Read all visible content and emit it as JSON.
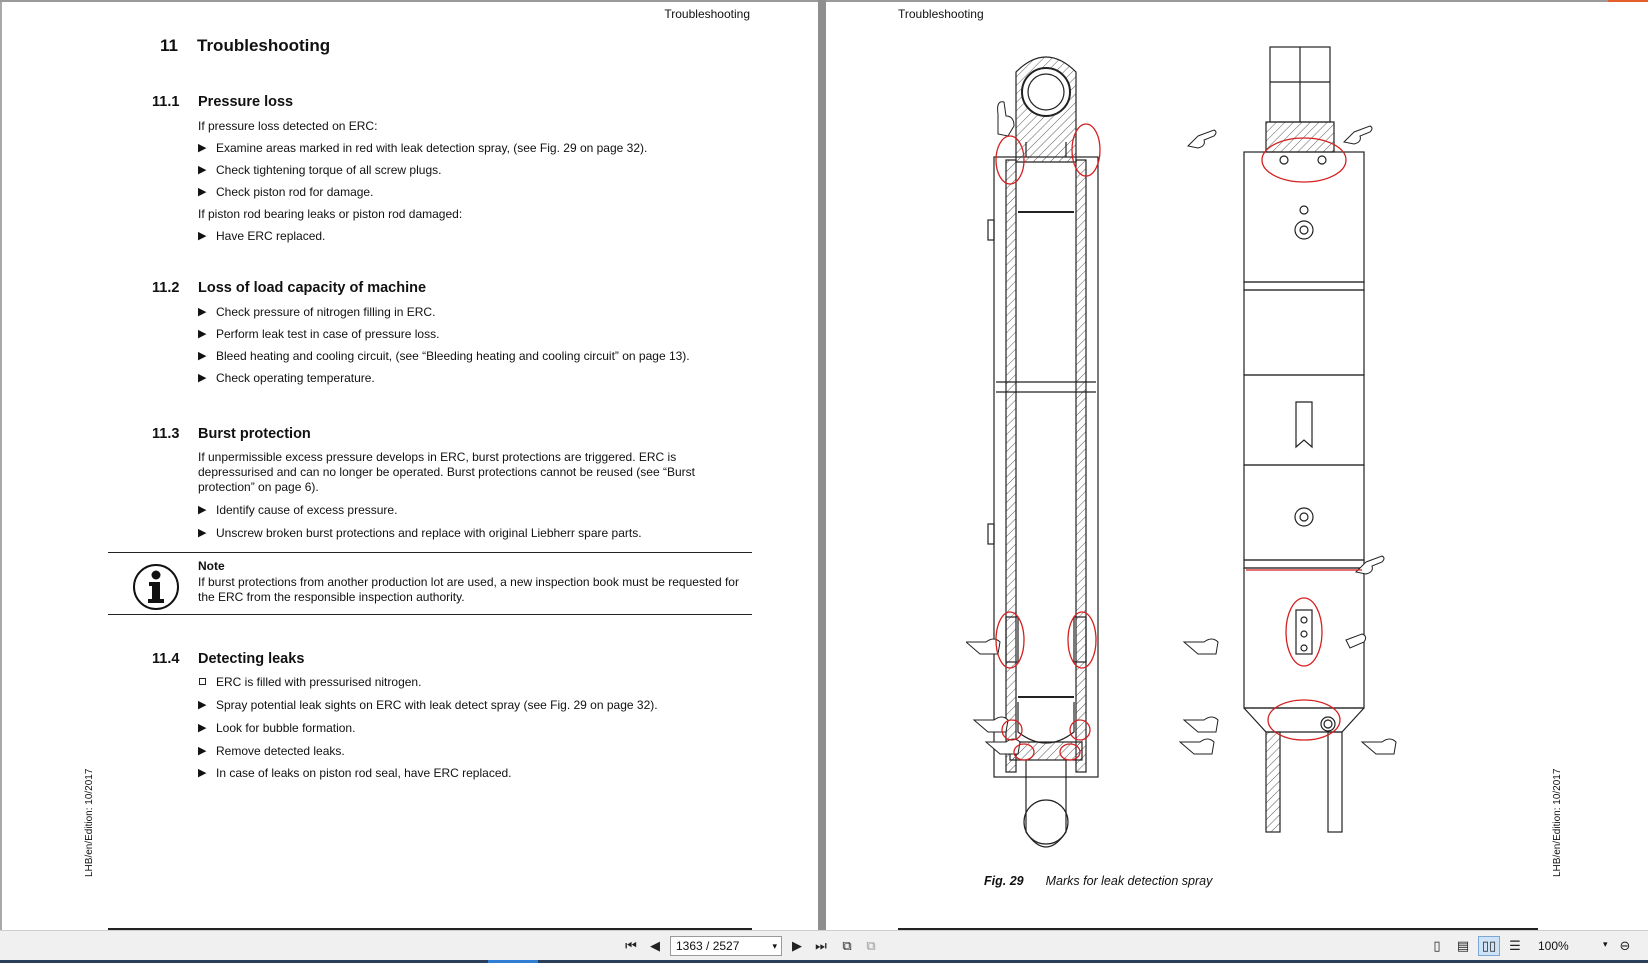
{
  "viewer": {
    "page_indicator": "1363 / 2527",
    "zoom": "100%",
    "icons": [
      "first-page-icon",
      "previous-page-icon",
      "next-page-icon",
      "last-page-icon",
      "copy-icon",
      "fit-icon",
      "single-page-icon",
      "continuous-icon",
      "two-page-icon",
      "two-page-continuous-icon",
      "zoom-out-icon"
    ]
  },
  "left_page": {
    "running_header": "Troubleshooting",
    "chapter": {
      "num": "11",
      "title": "Troubleshooting"
    },
    "s1": {
      "num": "11.1",
      "title": "Pressure loss",
      "intro": "If pressure loss detected on ERC:",
      "b1": "Examine areas marked in red with leak detection spray, (see Fig. 29 on page 32).",
      "b2": "Check tightening torque of all screw plugs.",
      "b3": "Check piston rod for damage.",
      "intro2": "If piston rod bearing leaks or piston rod damaged:",
      "b4": "Have ERC replaced."
    },
    "s2": {
      "num": "11.2",
      "title": "Loss of load capacity of machine",
      "b1": "Check pressure of nitrogen filling in ERC.",
      "b2": "Perform leak test in case of pressure loss.",
      "b3": "Bleed heating and cooling circuit, (see “Bleeding heating and cooling circuit” on page 13).",
      "b4": "Check operating temperature."
    },
    "s3": {
      "num": "11.3",
      "title": "Burst protection",
      "para": "If unpermissible excess pressure develops in ERC, burst protections are triggered. ERC is depressurised and can no longer be operated. Burst protections cannot be reused (see “Burst protection” on page 6).",
      "b1": "Identify cause of excess pressure.",
      "b2": "Unscrew broken burst protections and replace with original Liebherr spare parts."
    },
    "note": {
      "title": "Note",
      "text": "If burst protections from another production lot are used, a new inspection book must be requested for the ERC from the responsible inspection authority."
    },
    "s4": {
      "num": "11.4",
      "title": "Detecting leaks",
      "prereq": "ERC is filled with pressurised nitrogen.",
      "b1": "Spray potential leak sights on ERC with leak detect spray (see Fig. 29 on page 32).",
      "b2": "Look for bubble formation.",
      "b3": "Remove detected leaks.",
      "b4": "In case of leaks on piston rod seal, have ERC replaced."
    },
    "edition": "LHB/en/Edition: 10/2017"
  },
  "right_page": {
    "running_header": "Troubleshooting",
    "figure_label": "Fig. 29",
    "figure_caption": "Marks for leak detection spray",
    "edition": "LHB/en/Edition: 10/2017",
    "mark_color": "#d42020"
  }
}
